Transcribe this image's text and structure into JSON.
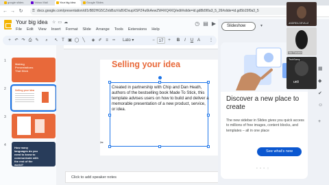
{
  "browser": {
    "tabs": [
      {
        "label": "google slides",
        "color": "#f4b400"
      },
      {
        "label": "Yahoo Mail",
        "color": "#6001d2"
      },
      {
        "label": "Your big idea",
        "color": "#f4b400",
        "active": true
      },
      {
        "label": "Google Slides",
        "color": "#f4b400"
      }
    ],
    "url": "docs.google.com/presentation/d/1rB82HG5CZnbBzzVuBXDxupXSPZ4u6kAewZW4XQ4XQ/edit#slide=id.gd8b5f0a3_5_26#slide=id.gd5b15f0a3_5"
  },
  "doc": {
    "title": "Your big idea",
    "menus": [
      "File",
      "Edit",
      "View",
      "Insert",
      "Format",
      "Slide",
      "Arrange",
      "Tools",
      "Extensions",
      "Help"
    ]
  },
  "toolbar": {
    "font_label": "Lato",
    "font_size": "17"
  },
  "filmstrip": {
    "slides": [
      {
        "num": "1",
        "title": "Making Presentations That Stick"
      },
      {
        "num": "2",
        "title": "Selling your idea"
      },
      {
        "num": "3",
        "title": ""
      },
      {
        "num": "4",
        "title": "How many languages do you need to know to communicate with the rest of the world?"
      }
    ]
  },
  "slide": {
    "title": "Selling your idea",
    "body": "Created in partnership with Chip and Dan Heath, authors of the bestselling book Made To Stick, this template advises users on how to build and deliver a memorable presentation of a new product, service, or idea."
  },
  "speaker_notes": {
    "placeholder": "Click to add speaker notes"
  },
  "header": {
    "slideshow_label": "Slideshow"
  },
  "sidepanel": {
    "title": "Discover a new place to create",
    "description": "The new sidebar in Slides gives you quick access to millions of free images, content blocks, and templates – all in one place",
    "button_label": "See what's new",
    "pager": "• • • ○"
  },
  "video": {
    "participants": [
      {
        "label": "ANDREA DEVILLE"
      },
      {
        "label": "Nur Farzana"
      },
      {
        "label": "TechSavvy"
      }
    ],
    "center_word": "unli"
  }
}
